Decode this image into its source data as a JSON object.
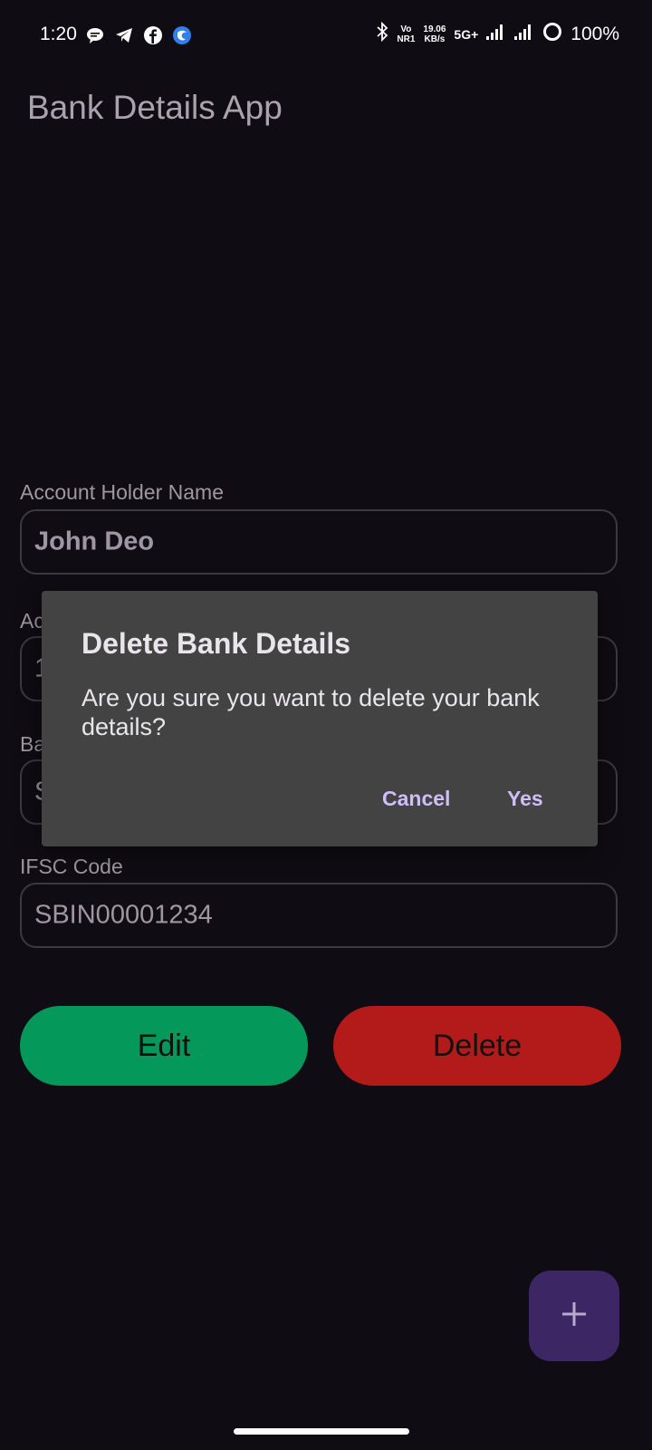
{
  "status_bar": {
    "time": "1:20",
    "icons_left": [
      "chat-bubble-icon",
      "telegram-icon",
      "facebook-icon",
      "app-notification-icon"
    ],
    "bluetooth": "bluetooth-icon",
    "volte_top": "Vo",
    "volte_bottom": "NR1",
    "speed_value": "19.06",
    "speed_unit": "KB/s",
    "network": "5G+",
    "battery": "100%"
  },
  "app": {
    "title": "Bank Details App"
  },
  "fields": {
    "account_holder": {
      "label": "Account Holder Name",
      "value": "John Deo"
    },
    "account_number": {
      "label": "Ac",
      "value": "1"
    },
    "bank_name": {
      "label": "Ba",
      "value": "S"
    },
    "ifsc": {
      "label": "IFSC Code",
      "value": "SBIN00001234"
    }
  },
  "buttons": {
    "edit": "Edit",
    "delete": "Delete"
  },
  "fab": {
    "icon": "plus-icon",
    "color": "#3c2764"
  },
  "dialog": {
    "title": "Delete Bank Details",
    "message": "Are you sure you want to delete your bank details?",
    "cancel": "Cancel",
    "confirm": "Yes"
  },
  "colors": {
    "background": "#0f0d13",
    "edit_button": "#04995a",
    "delete_button": "#b31b1b",
    "dialog_background": "#434343",
    "dialog_action": "#cfbcff"
  }
}
